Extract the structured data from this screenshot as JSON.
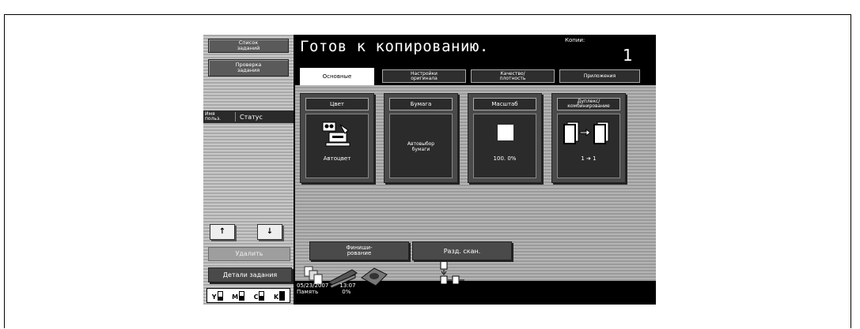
{
  "left": {
    "job_list": [
      "Список",
      "заданий"
    ],
    "job_check": [
      "Проверка",
      "задания"
    ],
    "user_col": [
      "Имя",
      "польз."
    ],
    "status_col": "Статус",
    "up_arrow": "↑",
    "down_arrow": "↓",
    "delete": "Удалить",
    "details": "Детали задания",
    "toner": [
      {
        "label": "Y",
        "level": 0.4
      },
      {
        "label": "M",
        "level": 0.5
      },
      {
        "label": "C",
        "level": 0.5
      },
      {
        "label": "K",
        "level": 1.0
      }
    ]
  },
  "header": {
    "title": "Готов к копированию.",
    "copies_label": "Копии:",
    "copies_value": "1"
  },
  "tabs": [
    {
      "label": [
        "Основные"
      ],
      "active": true
    },
    {
      "label": [
        "Настройки",
        "оригинала"
      ],
      "active": false
    },
    {
      "label": [
        "Качество/",
        "плотность"
      ],
      "active": false
    },
    {
      "label": [
        "Приложения"
      ],
      "active": false
    }
  ],
  "tiles": [
    {
      "header": [
        "Цвет"
      ],
      "value": [
        "Автоцвет"
      ],
      "icon": "color-printer-icon"
    },
    {
      "header": [
        "Бумага"
      ],
      "value": [
        "Автовыбор",
        "бумаги"
      ],
      "icon": ""
    },
    {
      "header": [
        "Масштаб"
      ],
      "value": [
        "100. 0%"
      ],
      "icon": "scale-square-icon"
    },
    {
      "header": [
        "Дуплекс/",
        "комбинирование"
      ],
      "value": [
        "1 ➔ 1"
      ],
      "icon": "duplex-pages-icon"
    }
  ],
  "bottom": {
    "finishing": [
      "Финиши-",
      "рование"
    ],
    "separate_scan": "Разд. скан."
  },
  "status": {
    "date": "05/23/2007",
    "time": "13:07",
    "memory_label": "Память",
    "memory_value": "0%"
  }
}
